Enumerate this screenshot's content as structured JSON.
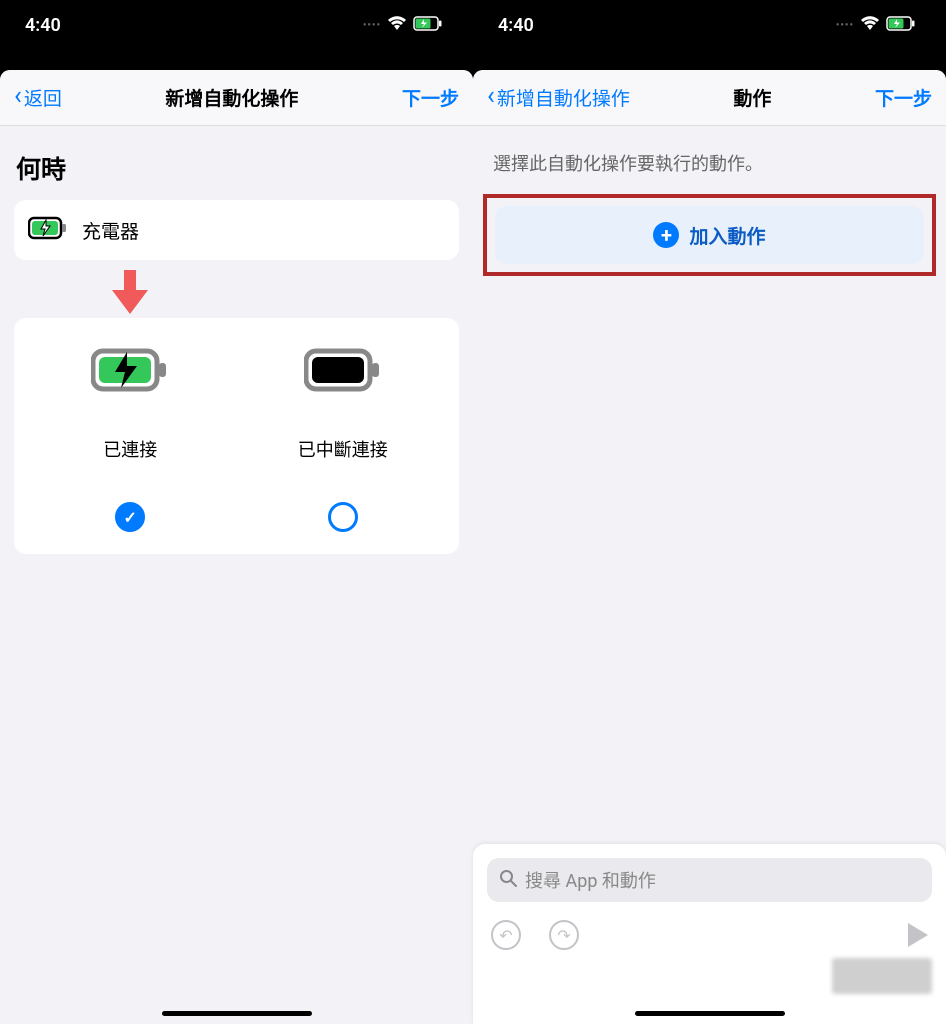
{
  "status": {
    "time": "4:40"
  },
  "left": {
    "nav": {
      "back": "返回",
      "title": "新增自動化操作",
      "next": "下一步"
    },
    "section": "何時",
    "charger_label": "充電器",
    "options": {
      "connected": {
        "label": "已連接",
        "selected": true
      },
      "disconnected": {
        "label": "已中斷連接",
        "selected": false
      }
    }
  },
  "right": {
    "nav": {
      "back": "新增自動化操作",
      "title": "動作",
      "next": "下一步"
    },
    "help_text": "選擇此自動化操作要執行的動作。",
    "add_action": "加入動作",
    "search_placeholder": "搜尋 App 和動作"
  }
}
